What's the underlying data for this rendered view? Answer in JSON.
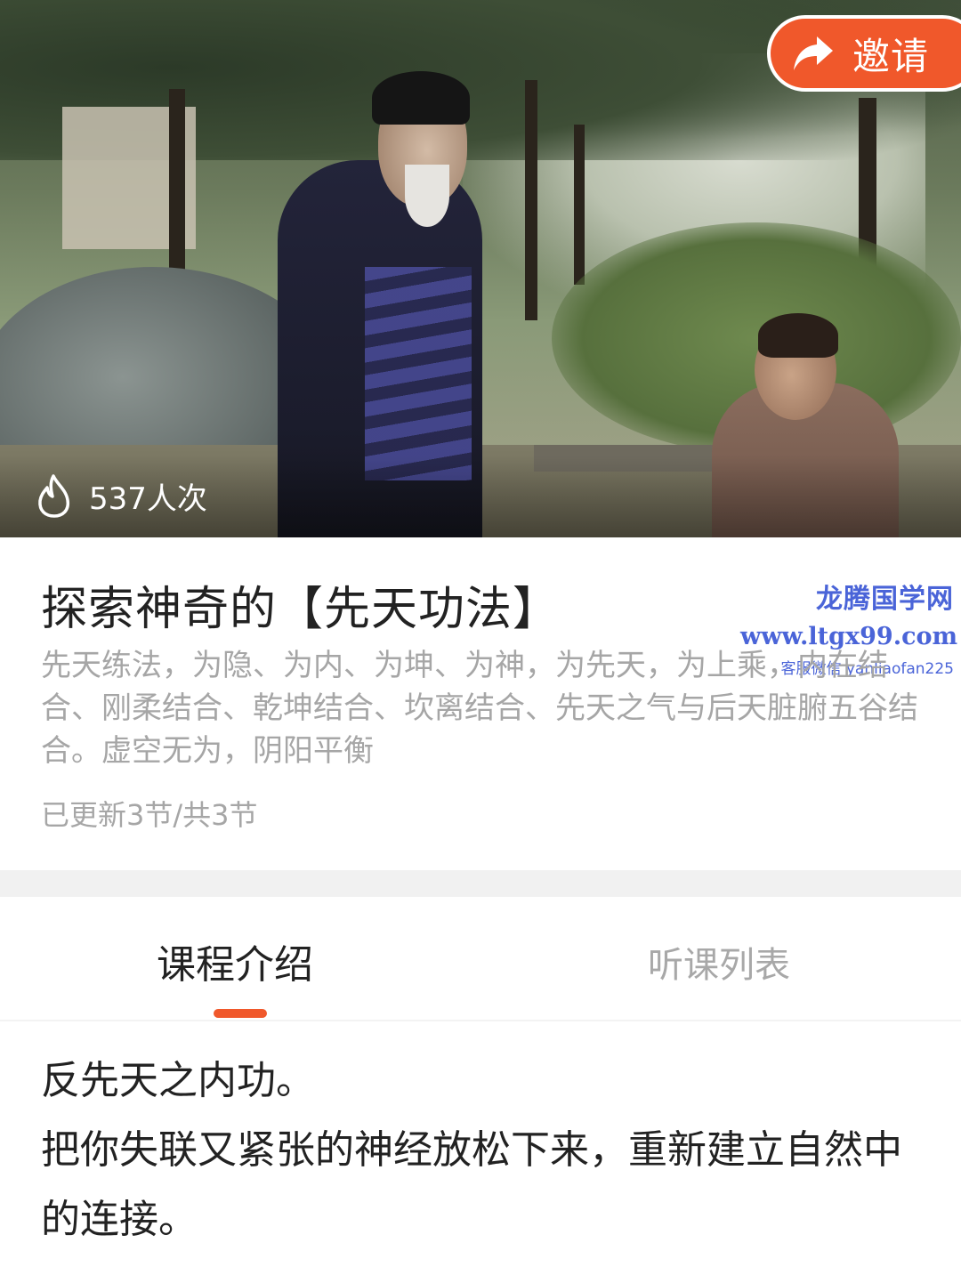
{
  "hero": {
    "invite_label": "邀请",
    "view_count": "537人次"
  },
  "course": {
    "title": "探索神奇的【先天功法】",
    "description": "先天练法，为隐、为内、为坤、为神，为先天，为上乘，内在结合、刚柔结合、乾坤结合、坎离结合、先天之气与后天脏腑五谷结合。虚空无为，阴阳平衡",
    "progress": "已更新3节/共3节"
  },
  "watermark": {
    "site_name": "龙腾国学网",
    "url": "www.ltgx99.com",
    "contact": "客服微信 yanliaofan225"
  },
  "tabs": [
    {
      "label": "课程介绍",
      "active": true
    },
    {
      "label": "听课列表",
      "active": false
    }
  ],
  "intro": {
    "line1": "反先天之内功。",
    "line2": "把你失联又紧张的神经放松下来，重新建立自然中的连接。"
  },
  "colors": {
    "accent": "#f0582b",
    "title_text": "#222222",
    "muted_text": "#a6a6a6",
    "watermark": "#4a64d8",
    "divider": "#f1f1f1"
  },
  "icons": {
    "invite": "share-arrow-icon",
    "views": "fire-icon"
  }
}
